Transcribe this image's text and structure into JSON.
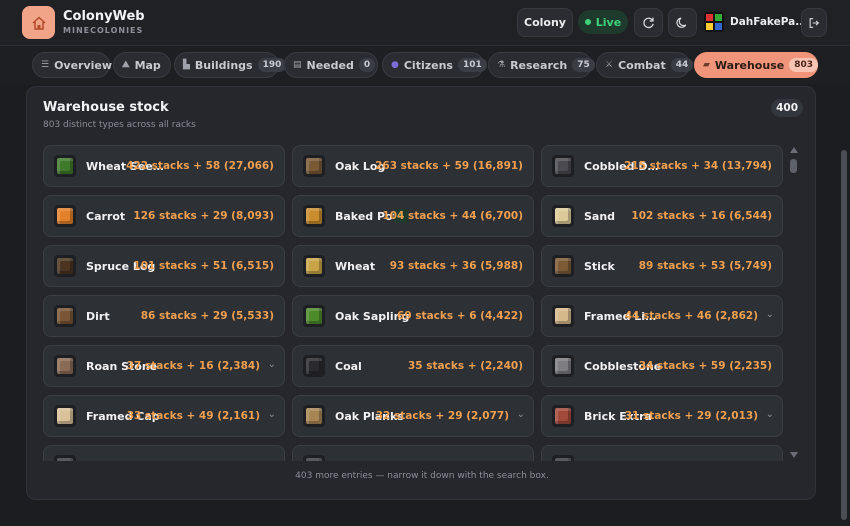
{
  "app": {
    "title": "ColonyWeb",
    "subtitle": "MINECOLONIES"
  },
  "header": {
    "colony_label": "Colony",
    "live_label": "Live",
    "username": "DahFakePa...",
    "icons": [
      "refresh-icon",
      "moon-icon",
      "logout-icon"
    ]
  },
  "tabs": [
    {
      "label": "Overview",
      "icon": "list-icon"
    },
    {
      "label": "Map",
      "icon": "map-icon"
    },
    {
      "label": "Buildings",
      "badge": "190",
      "icon": "building-icon"
    },
    {
      "label": "Needed",
      "badge": "0",
      "icon": "clipboard-icon"
    },
    {
      "label": "Citizens",
      "badge": "101",
      "icon": "person-icon"
    },
    {
      "label": "Research",
      "badge": "75",
      "icon": "flask-icon"
    },
    {
      "label": "Combat",
      "badge": "44",
      "icon": "swords-icon"
    },
    {
      "label": "Warehouse",
      "badge": "803",
      "icon": "crate-icon",
      "active": true
    }
  ],
  "warehouse": {
    "title": "Warehouse stock",
    "subtitle": "803 distinct types across all racks",
    "count": "400",
    "more_note": "403 more entries — narrow it down with the search box.",
    "items": [
      {
        "name": "Wheat Seeds",
        "stacks": "422 stacks + 58 (27,066)",
        "color": "#3f7a2c"
      },
      {
        "name": "Oak Log",
        "stacks": "263 stacks + 59 (16,891)",
        "color": "#7a5a35"
      },
      {
        "name": "Cobbled Deepslate",
        "stacks": "215 stacks + 34 (13,794)",
        "color": "#4a4a50"
      },
      {
        "name": "Carrot",
        "stacks": "126 stacks + 29 (8,093)",
        "color": "#e3802a"
      },
      {
        "name": "Baked Potato",
        "stacks": "104 stacks + 44 (6,700)",
        "color": "#c98d2e",
        "craftable": true
      },
      {
        "name": "Sand",
        "stacks": "102 stacks + 16 (6,544)",
        "color": "#dccb98"
      },
      {
        "name": "Spruce Log",
        "stacks": "101 stacks + 51 (6,515)",
        "color": "#4b3520"
      },
      {
        "name": "Wheat",
        "stacks": "93 stacks + 36 (5,988)",
        "color": "#c9a447"
      },
      {
        "name": "Stick",
        "stacks": "89 stacks + 53 (5,749)",
        "color": "#7d5a36"
      },
      {
        "name": "Dirt",
        "stacks": "86 stacks + 29 (5,533)",
        "color": "#7a5636"
      },
      {
        "name": "Oak Sapling",
        "stacks": "69 stacks + 6 (4,422)",
        "color": "#4d8a2a"
      },
      {
        "name": "Framed Light",
        "stacks": "44 stacks + 46 (2,862)",
        "color": "#d6b98a",
        "expandable": true
      },
      {
        "name": "Roan Stone",
        "stacks": "37 stacks + 16 (2,384)",
        "color": "#8a6b55",
        "expandable": true
      },
      {
        "name": "Coal",
        "stacks": "35 stacks + (2,240)",
        "color": "#2a2a2e"
      },
      {
        "name": "Cobblestone",
        "stacks": "34 stacks + 59 (2,235)",
        "color": "#7d7d82"
      },
      {
        "name": "Framed Cap",
        "stacks": "33 stacks + 49 (2,161)",
        "color": "#d9c19a",
        "expandable": true
      },
      {
        "name": "Oak Planks",
        "stacks": "32 stacks + 29 (2,077)",
        "color": "#a88654",
        "expandable": true
      },
      {
        "name": "Brick Extra",
        "stacks": "31 stacks + 29 (2,013)",
        "color": "#a2493a",
        "expandable": true
      },
      {
        "name": "",
        "stacks": "",
        "color": "#3a3d44"
      },
      {
        "name": "",
        "stacks": "",
        "color": "#3a3d44"
      },
      {
        "name": "",
        "stacks": "",
        "color": "#3a3d44"
      }
    ]
  }
}
